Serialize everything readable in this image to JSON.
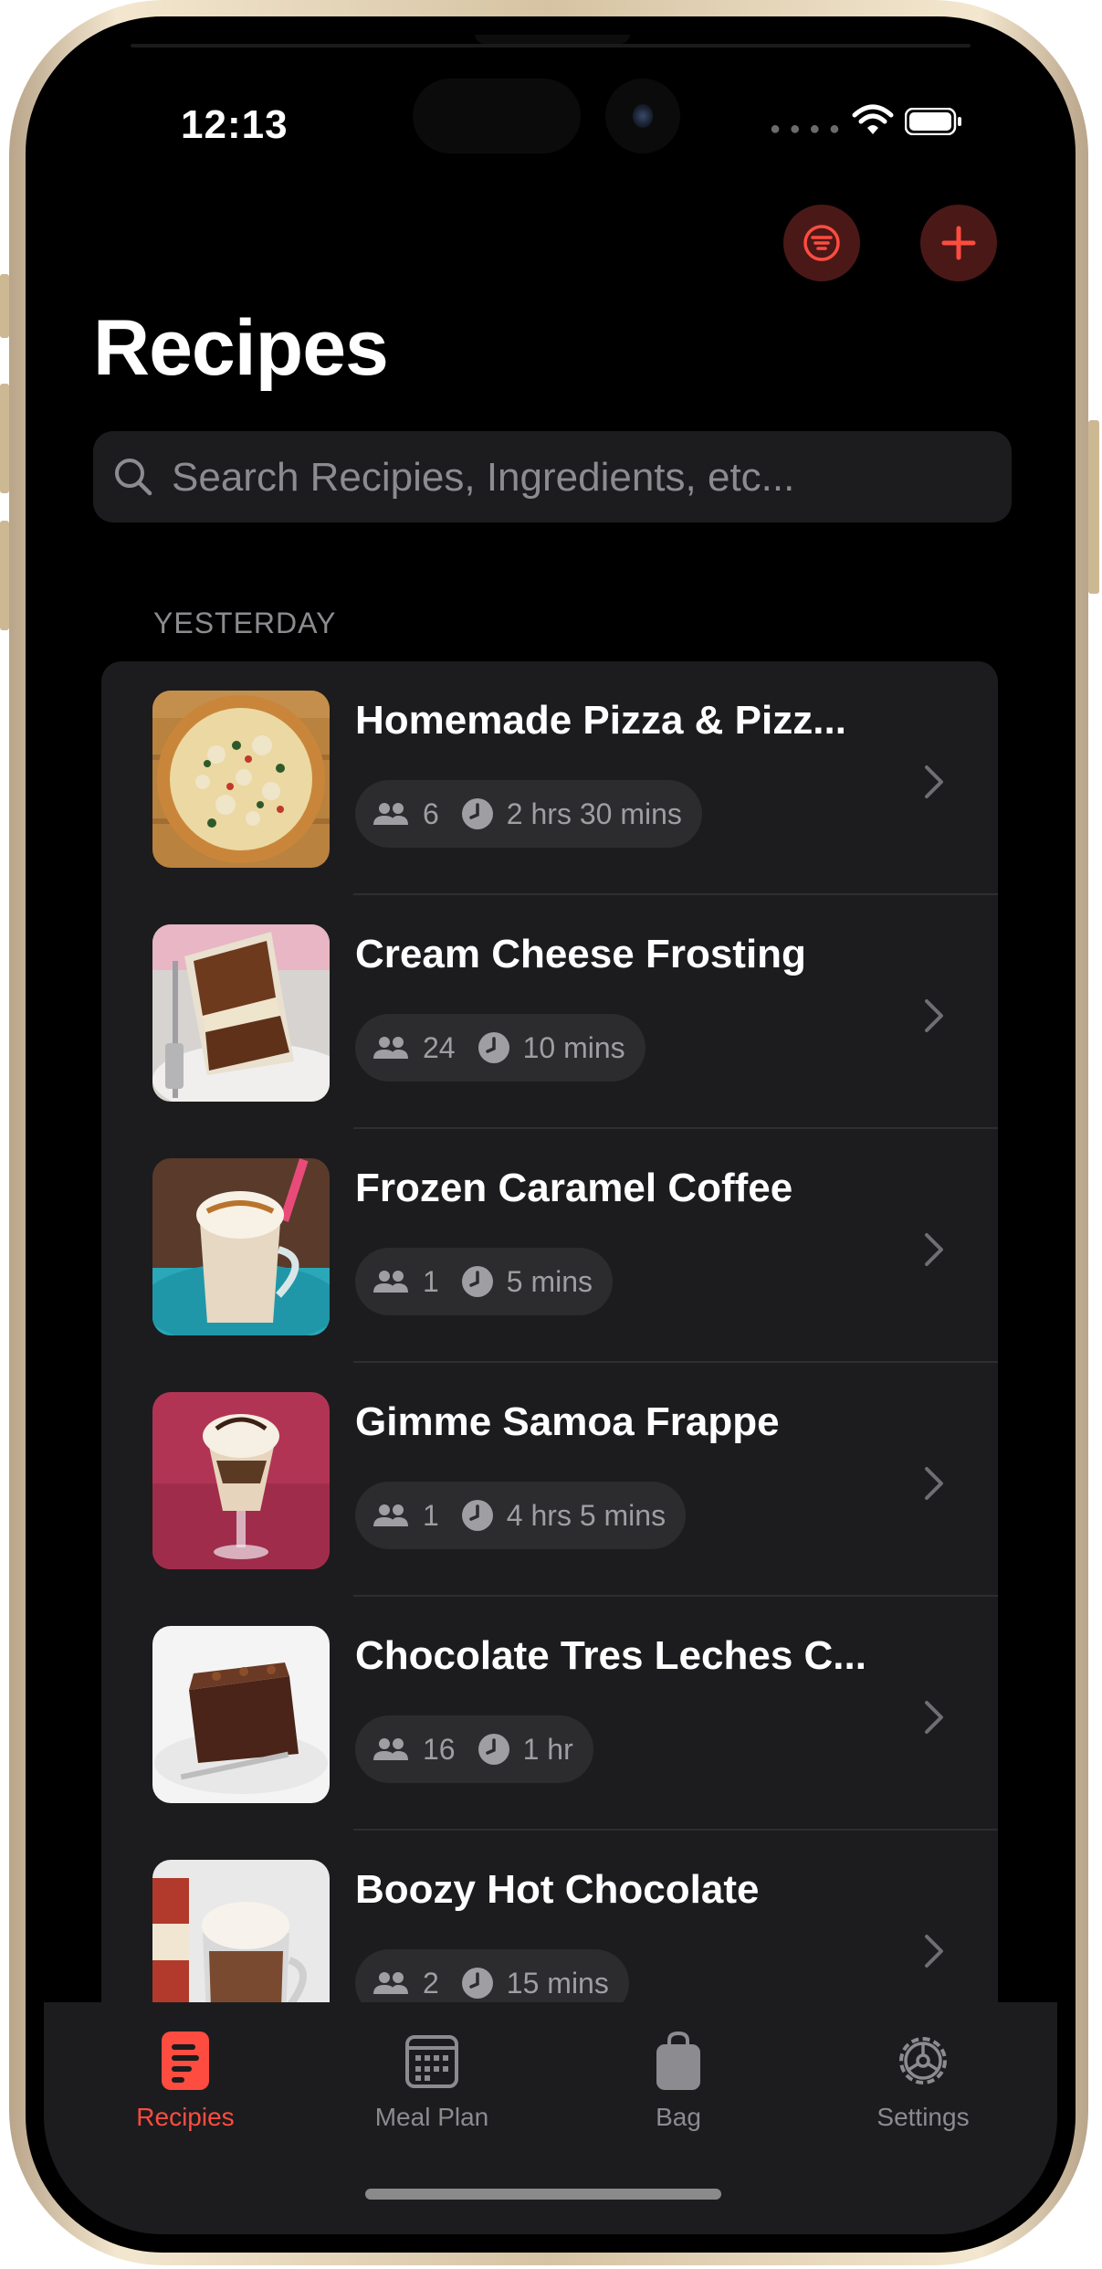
{
  "status_bar": {
    "time": "12:13"
  },
  "header": {
    "title": "Recipes",
    "accent_color": "#ff4c40",
    "buttons": {
      "filter_icon": "filter-lines-icon",
      "add_icon": "plus-icon"
    }
  },
  "search": {
    "placeholder": "Search Recipies, Ingredients, etc..."
  },
  "section": {
    "label": "YESTERDAY"
  },
  "recipes": [
    {
      "title": "Homemade Pizza & Pizz...",
      "servings": "6",
      "time": "2 hrs 30 mins",
      "thumb": "pizza"
    },
    {
      "title": "Cream Cheese Frosting",
      "servings": "24",
      "time": "10 mins",
      "thumb": "carrot-cake"
    },
    {
      "title": "Frozen Caramel Coffee",
      "servings": "1",
      "time": "5 mins",
      "thumb": "caramel-coffee"
    },
    {
      "title": "Gimme Samoa Frappe",
      "servings": "1",
      "time": "4 hrs 5 mins",
      "thumb": "frappe"
    },
    {
      "title": "Chocolate Tres Leches C...",
      "servings": "16",
      "time": "1 hr",
      "thumb": "chocolate-cake"
    },
    {
      "title": "Boozy Hot Chocolate",
      "servings": "2",
      "time": "15 mins",
      "thumb": "hot-chocolate"
    }
  ],
  "tabs": [
    {
      "label": "Recipies",
      "icon": "recipe-card-icon",
      "active": true
    },
    {
      "label": "Meal Plan",
      "icon": "calendar-icon",
      "active": false
    },
    {
      "label": "Bag",
      "icon": "shopping-bag-icon",
      "active": false
    },
    {
      "label": "Settings",
      "icon": "gear-icon",
      "active": false
    }
  ]
}
